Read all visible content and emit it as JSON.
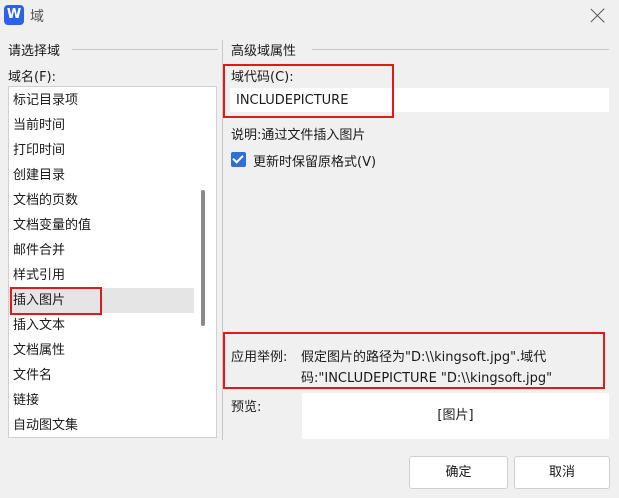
{
  "window": {
    "title": "域",
    "app_icon_letter": "W"
  },
  "left_group": {
    "heading": "请选择域",
    "field_label": "域名(F):",
    "items": [
      "标记目录项",
      "当前时间",
      "打印时间",
      "创建目录",
      "文档的页数",
      "文档变量的值",
      "邮件合并",
      "样式引用",
      "插入图片",
      "插入文本",
      "文档属性",
      "文件名",
      "链接",
      "自动图文集"
    ],
    "selected": "插入图片"
  },
  "right_group": {
    "heading": "高级域属性",
    "code_label": "域代码(C):",
    "code_value": "INCLUDEPICTURE",
    "description": "说明:通过文件插入图片",
    "keep_format_label": "更新时保留原格式(V)",
    "keep_format_checked": true,
    "example_label": "应用举例:",
    "example_line1": "假定图片的路径为\"D:\\\\kingsoft.jpg\".域代",
    "example_line2": "码:\"INCLUDEPICTURE \"D:\\\\kingsoft.jpg\"",
    "preview_label": "预览:",
    "preview_value": "[图片]"
  },
  "buttons": {
    "ok": "确定",
    "cancel": "取消"
  },
  "colors": {
    "accent": "#2f6fd6",
    "highlight_border": "#e01919",
    "app_icon": "#2b62e8"
  }
}
